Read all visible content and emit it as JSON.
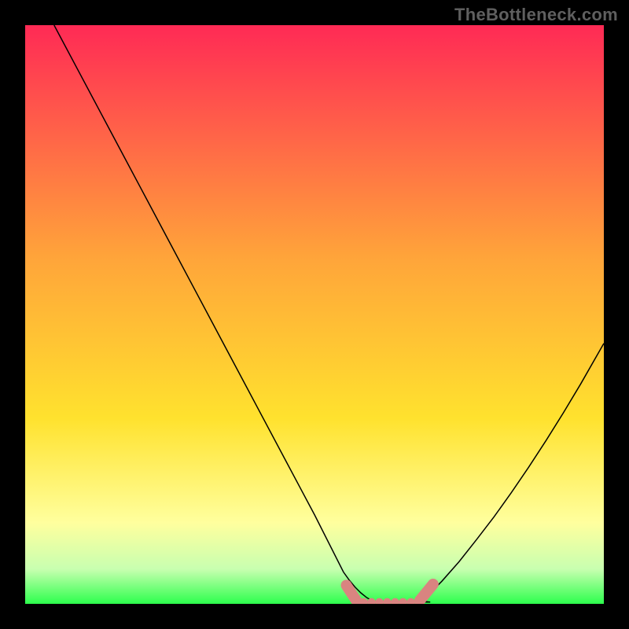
{
  "watermark": "TheBottleneck.com",
  "colors": {
    "gradient_top": "#ff2a55",
    "gradient_mid_orange": "#ffa43a",
    "gradient_yellow": "#ffe22e",
    "gradient_pale_yellow": "#ffff9e",
    "gradient_pale_green": "#c8ffb0",
    "gradient_green": "#2dff4d",
    "curve_color": "#000000",
    "highlight_color": "#d98480",
    "frame_color": "#000000"
  },
  "chart_data": {
    "type": "line",
    "title": "",
    "xlabel": "",
    "ylabel": "",
    "xlim": [
      0,
      100
    ],
    "ylim": [
      0,
      100
    ],
    "curve_left": {
      "x": [
        5,
        10,
        15,
        20,
        25,
        30,
        35,
        40,
        45,
        50,
        55,
        56,
        57,
        58,
        59,
        60
      ],
      "y": [
        100,
        90.6,
        81.2,
        71.8,
        62.4,
        53.0,
        43.6,
        34.2,
        24.8,
        15.4,
        5.5,
        4.1,
        2.9,
        1.9,
        1.1,
        0.5
      ]
    },
    "curve_right": {
      "x": [
        68,
        69,
        70,
        72,
        75,
        78,
        81,
        84,
        87,
        90,
        93,
        96,
        100
      ],
      "y": [
        0.5,
        1.1,
        1.9,
        3.9,
        7.3,
        11.1,
        15.0,
        19.2,
        23.6,
        28.2,
        33.0,
        38.0,
        45.0
      ]
    },
    "flat_bottom": {
      "x_start": 58,
      "x_end": 70,
      "y": 0.3
    },
    "optimal_range_highlight": {
      "x_start": 56,
      "x_end": 70,
      "y": 0.3
    }
  }
}
